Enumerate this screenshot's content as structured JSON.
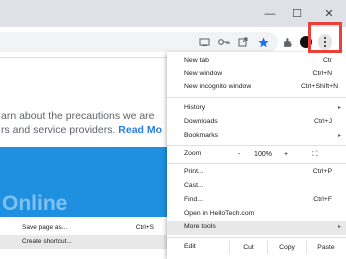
{
  "window": {
    "minimize_glyph": "—",
    "maximize_glyph": "☐",
    "close_glyph": "✕"
  },
  "toolbar": {
    "icons": [
      "cast-icon",
      "key-icon",
      "share-icon",
      "star-icon",
      "extensions-icon",
      "profile-avatar-icon",
      "menu-kebab-icon"
    ],
    "star_color": "#1a73e8"
  },
  "page": {
    "line1": "arn about the precautions we are",
    "line2_text": "rs and service providers. ",
    "line2_link": "Read Mo",
    "banner_text": "Online",
    "banner_color": "#1f8fe0"
  },
  "submenu": {
    "items": [
      {
        "label": "Save page as...",
        "shortcut": "Ctrl+S"
      },
      {
        "label": "Create shortcut...",
        "shortcut": ""
      }
    ]
  },
  "menu": {
    "new_tab": {
      "label": "New tab",
      "shortcut": "Ctr"
    },
    "new_window": {
      "label": "New window",
      "shortcut": "Ctrl+N"
    },
    "new_incognito": {
      "label": "New incognito window",
      "shortcut": "Ctrl+Shift+N"
    },
    "history": {
      "label": "History",
      "arrow": "▸"
    },
    "downloads": {
      "label": "Downloads",
      "shortcut": "Ctrl+J"
    },
    "bookmarks": {
      "label": "Bookmarks",
      "arrow": "▸"
    },
    "zoom": {
      "label": "Zoom",
      "minus": "-",
      "value": "100%",
      "plus": "+",
      "fullscreen": "⛶"
    },
    "print": {
      "label": "Print...",
      "shortcut": "Ctrl+P"
    },
    "cast": {
      "label": "Cast..."
    },
    "find": {
      "label": "Find...",
      "shortcut": "Ctrl+F"
    },
    "open_in": {
      "label": "Open in HelloTech.com"
    },
    "more_tools": {
      "label": "More tools",
      "arrow": "▸"
    },
    "edit": {
      "label": "Edit",
      "cut": "Cut",
      "copy": "Copy",
      "paste": "Paste"
    }
  },
  "highlight_color": "#e8403a"
}
